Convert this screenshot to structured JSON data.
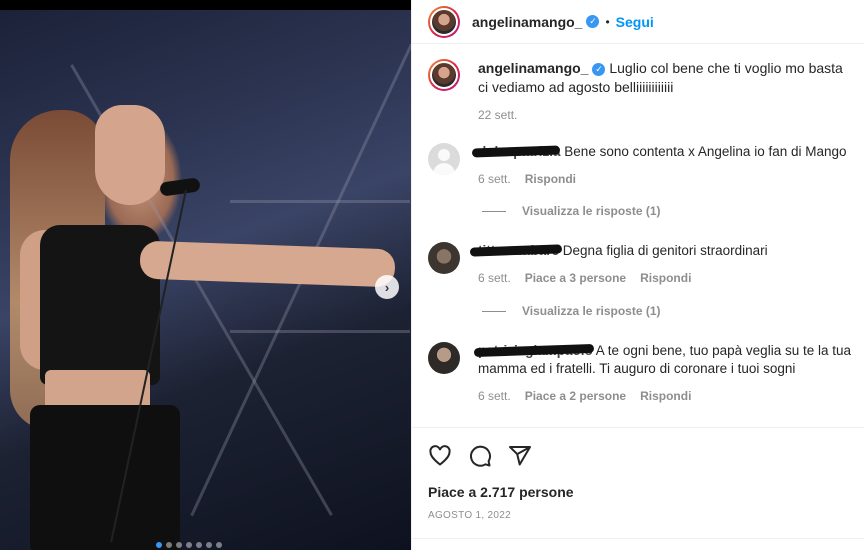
{
  "post": {
    "author": "angelinamango_",
    "follow_label": "Segui",
    "separator": "•",
    "caption_author": "angelinamango_",
    "caption_text": "Luglio col bene che ti voglio mo basta ci vediamo ad agosto belliiiiiiiiiiii",
    "caption_time": "22 sett.",
    "likes": "Piace a 2.717 persone",
    "date": "AGOSTO 1, 2022",
    "carousel": {
      "total": 7,
      "active": 1
    },
    "next_icon": "chevron-right-icon"
  },
  "comments": [
    {
      "user": "dolcepatrizia",
      "text": "Bene sono contenta x Angelina io fan di Mango",
      "time": "6 sett.",
      "likes": "",
      "reply": "Rispondi",
      "view_replies": "Visualizza le risposte (1)"
    },
    {
      "user": "tittocambare",
      "text": "Degna figlia di genitori straordinari",
      "time": "6 sett.",
      "likes": "Piace a 3 persone",
      "reply": "Rispondi",
      "view_replies": "Visualizza le risposte (1)"
    },
    {
      "user": "patriziagiampaolo",
      "text": "A te ogni bene, tuo papà veglia su te la tua mamma ed i fratelli. Ti auguro di coronare i tuoi sogni",
      "time": "6 sett.",
      "likes": "Piace a 2 persone",
      "reply": "Rispondi"
    }
  ],
  "icons": {
    "like": "heart-icon",
    "comment": "comment-icon",
    "share": "share-icon",
    "verified": "verified-badge-icon"
  },
  "colors": {
    "accent": "#0095f6",
    "verified": "#3897f0",
    "muted": "#8e8e8e"
  }
}
